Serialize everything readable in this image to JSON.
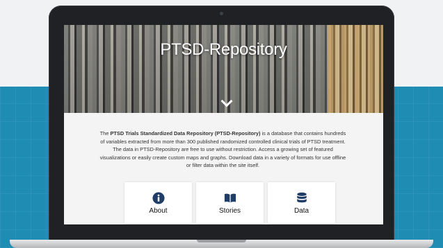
{
  "colors": {
    "accent_dark_blue": "#1f3d66",
    "background_teal": "#1f8cb4"
  },
  "hero": {
    "title": "PTSD-Repository",
    "scroll_icon": "chevron-down-icon"
  },
  "intro": {
    "lead": "The ",
    "bold_name": "PTSD Trials Standardized Data Repository (PTSD-Repository)",
    "body": " is a database that contains hundreds of variables extracted from more than 300 published randomized controlled clinical trials of PTSD treatment. The data in PTSD-Repository are free to use without restriction. Access a growing set of featured visualizations or easily create custom maps and graphs. Download data in a variety of formats for use offline or filter data within the site itself."
  },
  "cards": [
    {
      "label": "About",
      "icon": "info-icon"
    },
    {
      "label": "Stories",
      "icon": "book-icon"
    },
    {
      "label": "Data",
      "icon": "database-icon"
    }
  ]
}
